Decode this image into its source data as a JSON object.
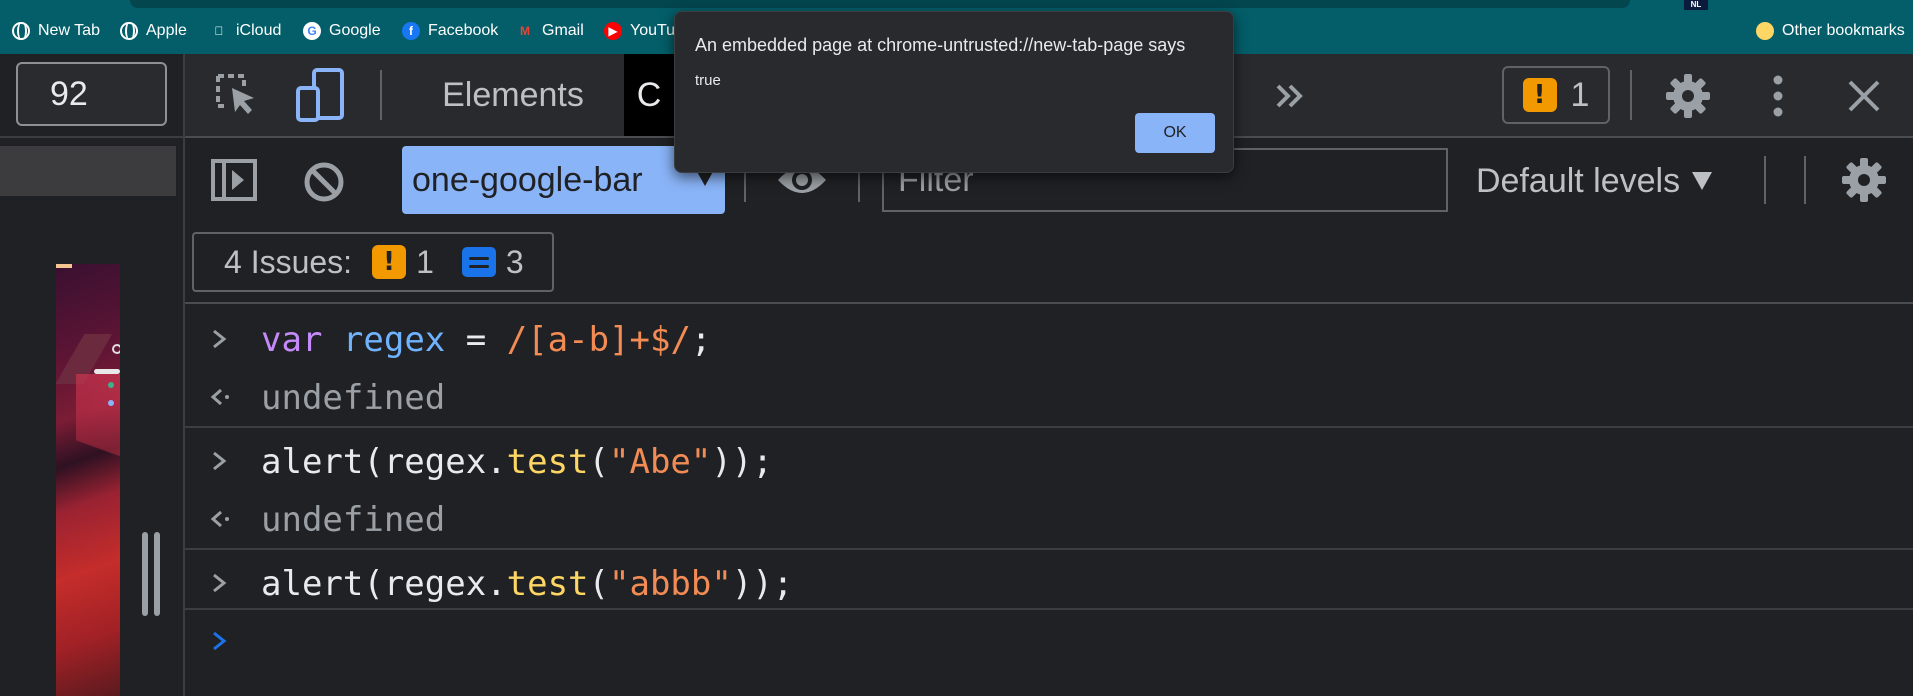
{
  "bookmarks": {
    "items": [
      {
        "label": "New Tab",
        "icon": "globe-icon"
      },
      {
        "label": "Apple",
        "icon": "globe-icon"
      },
      {
        "label": "iCloud",
        "icon": "apple-icon"
      },
      {
        "label": "Google",
        "icon": "google-icon"
      },
      {
        "label": "Facebook",
        "icon": "facebook-icon"
      },
      {
        "label": "Gmail",
        "icon": "gmail-icon"
      },
      {
        "label": "YouTu",
        "icon": "youtube-icon"
      }
    ],
    "other": "Other bookmarks",
    "profile_badge": "NL"
  },
  "page": {
    "zoom": "92"
  },
  "devtools": {
    "tabs": [
      {
        "label": "Elements",
        "active": false
      },
      {
        "label": "C",
        "active": true
      }
    ],
    "issues_count": "1",
    "console": {
      "context": "one-google-bar",
      "filter_placeholder": "Filter",
      "levels": "Default levels"
    },
    "issues_bar": {
      "label": "4 Issues:",
      "warnings": "1",
      "infos": "3"
    },
    "lines": [
      {
        "type": "input",
        "parts": [
          [
            "kw",
            "var"
          ],
          [
            "op",
            " "
          ],
          [
            "var",
            "regex"
          ],
          [
            "op",
            " = "
          ],
          [
            "rx",
            "/[a-b]+$/"
          ],
          [
            "op",
            ";"
          ]
        ]
      },
      {
        "type": "output",
        "text": "undefined"
      },
      {
        "type": "input",
        "parts": [
          [
            "plain",
            "alert(regex."
          ],
          [
            "fn",
            "test"
          ],
          [
            "plain",
            "("
          ],
          [
            "str",
            "\"Abe\""
          ],
          [
            "plain",
            "));"
          ]
        ]
      },
      {
        "type": "output",
        "text": "undefined"
      },
      {
        "type": "input",
        "parts": [
          [
            "plain",
            "alert(regex."
          ],
          [
            "fn",
            "test"
          ],
          [
            "plain",
            "("
          ],
          [
            "str",
            "\"abbb\""
          ],
          [
            "plain",
            "));"
          ]
        ]
      }
    ]
  },
  "dialog": {
    "title": "An embedded page at chrome-untrusted://new-tab-page says",
    "message": "true",
    "ok_label": "OK"
  },
  "colors": {
    "bookmarks_bg": "#035e69",
    "accent_blue": "#8ab4f8",
    "warning": "#f29900",
    "info": "#1a73e8"
  }
}
